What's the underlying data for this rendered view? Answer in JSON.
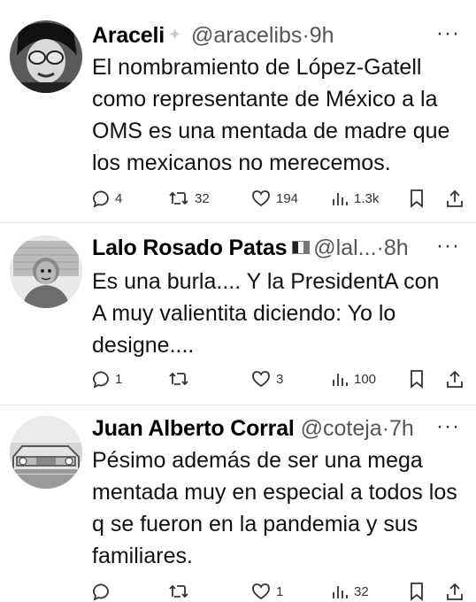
{
  "tweets": [
    {
      "name": "Araceli",
      "badge": "sparkle",
      "handle": "@aracelibs",
      "sep": "·",
      "time": "9h",
      "more": "···",
      "body": "El nombramiento de López-Gatell como representante de México a la OMS es una mentada de madre que los mexicanos no merecemos.",
      "replies": "4",
      "reposts": "32",
      "likes": "194",
      "views": "1.3k"
    },
    {
      "name": "Lalo Rosado Patas",
      "badge": "flag-mexico",
      "handle": "@lal...",
      "sep": "·",
      "time": "8h",
      "more": "···",
      "body": "Es una burla.... Y la PresidentA con A muy valientita diciendo: Yo lo designe....",
      "replies": "1",
      "reposts": "",
      "likes": "3",
      "views": "100"
    },
    {
      "name": "Juan Alberto Corral",
      "badge": "",
      "handle": "@coteja",
      "sep": "·",
      "time": "7h",
      "more": "···",
      "body": "Pésimo además de ser una mega mentada muy en especial a todos los q se fueron en la pandemia y sus familiares.",
      "replies": "",
      "reposts": "",
      "likes": "1",
      "views": "32"
    }
  ],
  "icons": {
    "reply": "reply-icon",
    "repost": "repost-icon",
    "like": "heart-icon",
    "views": "views-icon",
    "bookmark": "bookmark-icon",
    "share": "share-icon"
  }
}
